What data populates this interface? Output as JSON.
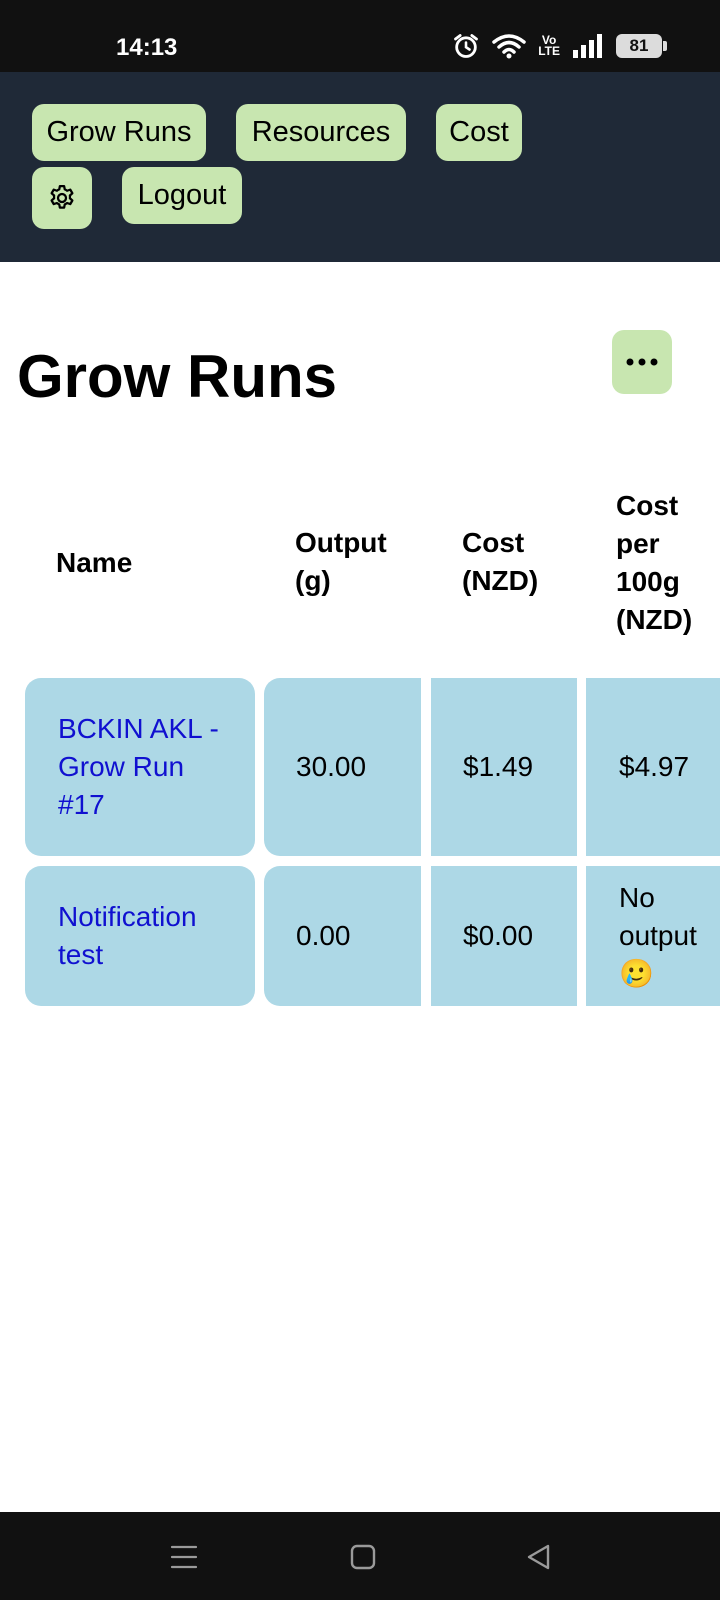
{
  "status_bar": {
    "time": "14:13",
    "volte_label": "Vo\nLTE",
    "battery": "81",
    "icons": [
      "alarm-icon",
      "wifi-icon",
      "signal-icon",
      "battery-icon"
    ]
  },
  "nav": {
    "grow_runs": "Grow Runs",
    "resources": "Resources",
    "cost": "Cost",
    "settings_icon": "gear-icon",
    "logout": "Logout"
  },
  "page": {
    "title": "Grow Runs",
    "more_icon": "ellipsis-icon"
  },
  "table": {
    "headers": [
      "Name",
      "Output (g)",
      "Cost (NZD)",
      "Cost per 100g (NZD)"
    ],
    "rows": [
      {
        "name": "BCKIN AKL - Grow Run #17",
        "output": "30.00",
        "cost": "$1.49",
        "cost_per_100g": "$4.97"
      },
      {
        "name": "Notification test",
        "output": "0.00",
        "cost": "$0.00",
        "cost_per_100g": "No output 🥲"
      }
    ]
  },
  "colors": {
    "nav_background": "#1f2937",
    "button_green": "#c8e6b0",
    "cell_blue": "#add8e6",
    "link_blue": "#1010d0"
  }
}
